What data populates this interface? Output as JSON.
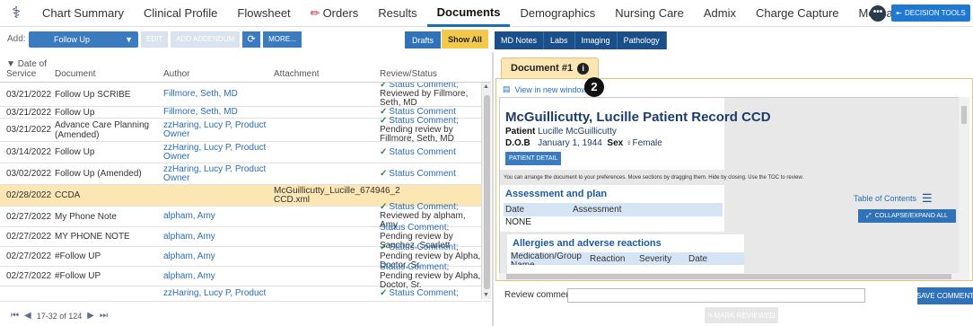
{
  "nav": {
    "tabs": [
      "Chart Summary",
      "Clinical Profile",
      "Flowsheet",
      "Orders",
      "Results",
      "Documents",
      "Demographics",
      "Nursing Care",
      "Admix",
      "Charge Capture",
      "Messages"
    ],
    "active_tab": "Documents",
    "more_label": "•••",
    "decision_tools_label": "DECISION TOOLS"
  },
  "toolbar": {
    "add_label": "Add:",
    "add_select_value": "Follow Up",
    "edit_label": "EDIT",
    "add_addendum_label": "ADD ADDENDUM",
    "refresh_label": "⟳",
    "more_label": "MORE...",
    "drafts_label": "Drafts",
    "show_all_label": "Show All"
  },
  "filter_tabs": [
    "MD Notes",
    "Labs",
    "Imaging",
    "Pathology"
  ],
  "table": {
    "headers": {
      "date": "Date of Service",
      "document": "Document",
      "author": "Author",
      "attachment": "Attachment",
      "review": "Review/Status"
    },
    "rows": [
      {
        "date": "03/21/2022",
        "document": "Follow Up SCRIBE",
        "author": "Fillmore, Seth, MD",
        "attachment": "",
        "review_link": "Status Comment;",
        "review_text": "Reviewed by Fillmore, Seth, MD",
        "check": true,
        "highlight": false
      },
      {
        "date": "03/21/2022",
        "document": "Follow Up",
        "author": "Fillmore, Seth, MD",
        "attachment": "",
        "review_link": "Status Comment",
        "review_text": "",
        "check": true,
        "highlight": false
      },
      {
        "date": "03/21/2022",
        "document": "Advance Care Planning (Amended)",
        "author": "zzHaring, Lucy P, Product Owner",
        "attachment": "",
        "review_link": "Status Comment;",
        "review_text": "Pending review by Fillmore, Seth, MD",
        "check": true,
        "highlight": false
      },
      {
        "date": "03/14/2022",
        "document": "Follow Up",
        "author": "zzHaring, Lucy P, Product Owner",
        "attachment": "",
        "review_link": "Status Comment",
        "review_text": "",
        "check": true,
        "highlight": false
      },
      {
        "date": "03/02/2022",
        "document": "Follow Up (Amended)",
        "author": "zzHaring, Lucy P, Product Owner",
        "attachment": "",
        "review_link": "Status Comment",
        "review_text": "",
        "check": true,
        "highlight": false
      },
      {
        "date": "02/28/2022",
        "document": "CCDA",
        "author": "",
        "attachment": "McGuillicutty_Lucille_674946_2 CCD.xml",
        "review_link": "",
        "review_text": "",
        "check": false,
        "highlight": true
      },
      {
        "date": "02/27/2022",
        "document": "My Phone Note",
        "author": "alpham, Amy",
        "attachment": "",
        "review_link": "Status Comment;",
        "review_text": "Reviewed by alpham, Amy",
        "check": true,
        "highlight": false
      },
      {
        "date": "02/27/2022",
        "document": "MY PHONE NOTE",
        "author": "alpham, Amy",
        "attachment": "",
        "review_link": "Status Comment;",
        "review_text": "Pending review by Sanchez, Scarlett",
        "check": false,
        "highlight": false
      },
      {
        "date": "02/27/2022",
        "document": "#Follow UP",
        "author": "alpham, Amy",
        "attachment": "",
        "review_link": "Status Comment;",
        "review_text": "Pending review by Alpha, Doctor, Sr.",
        "check": true,
        "highlight": false
      },
      {
        "date": "02/27/2022",
        "document": "#Follow UP",
        "author": "alpham, Amy",
        "attachment": "",
        "review_link": "Status Comment;",
        "review_text": "Pending review by Alpha, Doctor, Sr.",
        "check": false,
        "highlight": false
      },
      {
        "date": "",
        "document": "",
        "author": "zzHaring, Lucy P, Product",
        "attachment": "",
        "review_link": "Status Comment;",
        "review_text": "",
        "check": true,
        "highlight": false
      }
    ]
  },
  "pager": {
    "range_text": "17-32 of 124"
  },
  "viewer": {
    "doc_tab_label": "Document #1",
    "info_icon": "i",
    "view_link": "View in new window",
    "badge": "2",
    "ccd_title": "McGuillicutty, Lucille Patient Record CCD",
    "patient_label": "Patient",
    "patient_name": "Lucille McGuillicutty",
    "dob_label": "D.O.B",
    "dob": "January 1, 1944",
    "sex_label": "Sex",
    "sex": "♀Female",
    "patient_detail_btn": "PATIENT DETAIL",
    "arrange_note": "You can arrange the document to your preferences. Move sections by dragging them. Hide by closing. Use the TOC to review.",
    "section1_title": "Assessment and plan",
    "section1_headers": [
      "Date",
      "Assessment"
    ],
    "section1_row": "NONE",
    "section2_title": "Allergies and adverse reactions",
    "section2_headers": [
      "Medication/Group Name",
      "Reaction",
      "Severity",
      "Date"
    ],
    "toc_label": "Table of Contents",
    "collapse_label": "COLLAPSE/EXPAND ALL"
  },
  "review": {
    "label": "Review comment:",
    "value": "",
    "save_label": "SAVE COMMENT",
    "mark_label": "MARK REVIEWED"
  }
}
